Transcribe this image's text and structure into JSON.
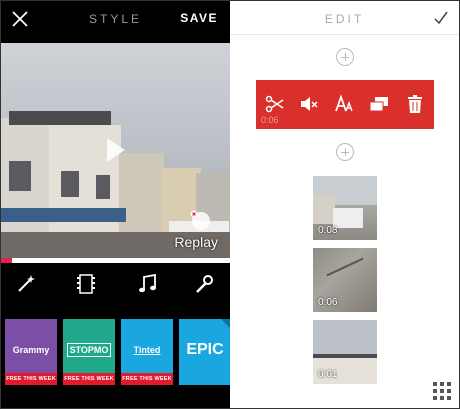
{
  "left_panel": {
    "title": "STYLE",
    "save_label": "SAVE",
    "video": {
      "replay_label": "Replay",
      "progress": 0.05
    },
    "tools": [
      "magic-wand",
      "film",
      "music",
      "wrench"
    ],
    "filters": [
      {
        "name": "Grammy",
        "badge": "FREE THIS WEEK",
        "color": "#7b4fa6"
      },
      {
        "name": "STOPMO",
        "badge": "FREE THIS WEEK",
        "color": "#1fa88a"
      },
      {
        "name": "Tinted",
        "badge": "FREE THIS WEEK",
        "color": "#1aa7e0"
      },
      {
        "name": "EPIC",
        "badge": "",
        "color": "#1aa7e0"
      }
    ]
  },
  "right_panel": {
    "title": "EDIT",
    "edit_bar": {
      "time": "0:06",
      "tools": [
        "scissors-icon",
        "mute-icon",
        "text-icon",
        "duplicate-icon",
        "trash-icon"
      ],
      "color": "#d9302b"
    },
    "clips": [
      {
        "duration": "0:08"
      },
      {
        "duration": "0:06"
      },
      {
        "duration": "0:01"
      }
    ]
  },
  "colors": {
    "accent": "#e5224b",
    "edit_red": "#d9302b"
  }
}
